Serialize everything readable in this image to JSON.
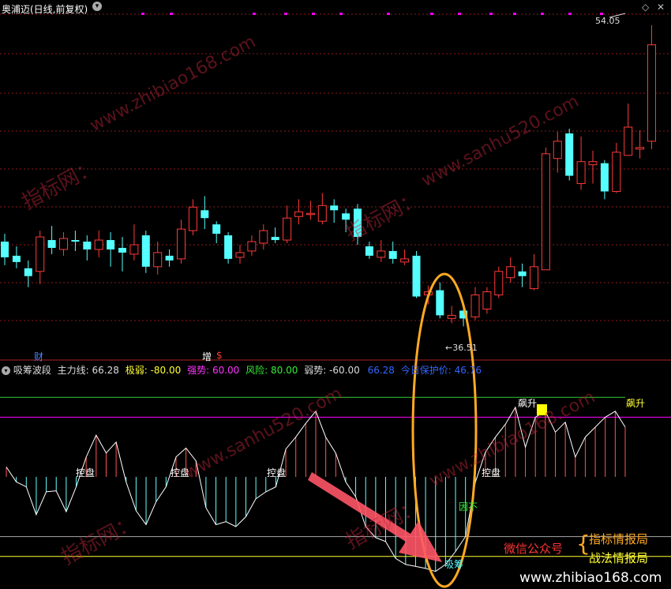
{
  "header": {
    "title": "奥浦迈(日线,前复权)",
    "collapse_icon": "chevron-down-icon"
  },
  "top_right_icons": [
    "diamond-icon",
    "close-icon"
  ],
  "indicator_header": {
    "name": "吸筹波段",
    "main_force": "主力线: 66.28",
    "extreme_weak": "极弱: -80.00",
    "strong": "强势: 60.00",
    "risk": "风险: 80.00",
    "weak": "弱势: -60.00",
    "value_blue": "66.28",
    "today_price": "今日保护价: 46.76"
  },
  "price_labels": {
    "high": "54.05",
    "low": "36.51"
  },
  "markers": {
    "cai": "财",
    "zeng": "增",
    "s": "$"
  },
  "indicator_labels": {
    "kongpan": "控盘",
    "biaosheng": "飙升",
    "xichou": "吸筹",
    "yinchu": "因不"
  },
  "watermarks": {
    "site1": "www.zhibiao168.com",
    "site2": "www.sanhu520.com",
    "brand": "指标网：",
    "wechat": "微信公众号",
    "brand_a": "指标情报局",
    "brand_b": "战法情报局",
    "footer": "www.zhibiao168.com"
  },
  "colors": {
    "up": "#ff3a3a",
    "down": "#55ffff",
    "magenta": "#ff00ff",
    "green_line": "#33cc33",
    "yellow_line": "#ffff33",
    "ellipse": "#ffaa22",
    "arrow": "#ff5566"
  },
  "chart_data": {
    "type": "candlestick",
    "price_ylim": [
      34,
      56
    ],
    "candles": [
      [
        41.5,
        40.5,
        42.0,
        40.0
      ],
      [
        40.6,
        40.2,
        41.2,
        39.8
      ],
      [
        39.8,
        39.3,
        40.3,
        38.6
      ],
      [
        39.6,
        41.8,
        42.2,
        38.8
      ],
      [
        41.6,
        41.1,
        42.5,
        40.7
      ],
      [
        41.0,
        41.7,
        42.1,
        40.6
      ],
      [
        41.6,
        41.5,
        42.2,
        40.9
      ],
      [
        41.5,
        41.0,
        41.9,
        40.3
      ],
      [
        41.0,
        41.6,
        42.2,
        40.5
      ],
      [
        41.6,
        41.0,
        42.1,
        39.9
      ],
      [
        41.1,
        40.8,
        41.8,
        39.6
      ],
      [
        40.7,
        41.3,
        42.6,
        40.3
      ],
      [
        41.9,
        39.9,
        42.2,
        39.5
      ],
      [
        39.9,
        40.8,
        41.5,
        39.4
      ],
      [
        40.6,
        40.3,
        41.0,
        39.9
      ],
      [
        40.4,
        42.3,
        42.9,
        40.1
      ],
      [
        42.2,
        43.7,
        44.2,
        41.9
      ],
      [
        43.5,
        43.0,
        44.4,
        42.3
      ],
      [
        42.6,
        42.0,
        42.8,
        41.4
      ],
      [
        41.9,
        40.4,
        42.1,
        40.1
      ],
      [
        40.5,
        40.8,
        41.3,
        40.1
      ],
      [
        40.9,
        41.5,
        41.9,
        40.6
      ],
      [
        41.4,
        42.2,
        42.6,
        41.0
      ],
      [
        41.8,
        41.6,
        42.4,
        41.4
      ],
      [
        41.6,
        43.0,
        43.8,
        41.4
      ],
      [
        43.1,
        43.4,
        44.2,
        42.6
      ],
      [
        43.3,
        43.3,
        44.1,
        42.9
      ],
      [
        42.8,
        43.8,
        44.6,
        42.6
      ],
      [
        43.8,
        43.5,
        44.2,
        42.7
      ],
      [
        43.3,
        42.9,
        43.6,
        42.1
      ],
      [
        43.6,
        41.8,
        43.9,
        41.3
      ],
      [
        41.2,
        40.6,
        41.5,
        40.4
      ],
      [
        40.5,
        40.9,
        41.6,
        40.2
      ],
      [
        40.9,
        40.4,
        41.5,
        40.1
      ],
      [
        40.2,
        40.4,
        41.0,
        40.0
      ],
      [
        40.6,
        38.0,
        40.9,
        37.9
      ],
      [
        38.1,
        38.3,
        38.7,
        37.5
      ],
      [
        38.4,
        36.8,
        38.9,
        36.6
      ],
      [
        36.6,
        36.8,
        37.4,
        36.3
      ],
      [
        37.1,
        36.6,
        37.4,
        36.1
      ],
      [
        36.7,
        38.1,
        38.6,
        36.5
      ],
      [
        37.2,
        38.3,
        38.6,
        36.9
      ],
      [
        38.1,
        39.6,
        39.9,
        37.9
      ],
      [
        39.2,
        39.9,
        40.5,
        38.9
      ],
      [
        39.6,
        39.3,
        40.1,
        38.6
      ],
      [
        38.5,
        39.9,
        40.7,
        38.4
      ],
      [
        39.7,
        47.1,
        47.5,
        39.7
      ],
      [
        46.8,
        47.9,
        48.5,
        45.9
      ],
      [
        48.4,
        45.7,
        48.7,
        45.4
      ],
      [
        45.2,
        46.6,
        48.2,
        44.8
      ],
      [
        46.4,
        46.6,
        47.3,
        45.2
      ],
      [
        46.5,
        44.7,
        46.7,
        44.2
      ],
      [
        44.7,
        47.2,
        47.8,
        44.6
      ],
      [
        47.0,
        48.8,
        50.3,
        47.1
      ],
      [
        47.4,
        47.5,
        48.6,
        46.8
      ],
      [
        47.9,
        54.05,
        55.3,
        47.4
      ]
    ],
    "indicator_ylim": [
      -100,
      100
    ],
    "indicator_levels": {
      "risk": 80,
      "strong": 60,
      "zero": 0,
      "weak": -60,
      "extreme_weak": -80
    },
    "indicator": [
      10,
      -5,
      -10,
      -38,
      -15,
      -14,
      -35,
      -10,
      20,
      42,
      24,
      35,
      -5,
      -34,
      -48,
      -25,
      -10,
      20,
      29,
      16,
      -31,
      -48,
      -45,
      -50,
      -40,
      -22,
      -15,
      -10,
      28,
      40,
      54,
      66,
      40,
      24,
      -5,
      -20,
      -50,
      -61,
      -65,
      -82,
      -88,
      -90,
      -92,
      -95,
      -88,
      -75,
      -60,
      -5,
      25,
      40,
      53,
      70,
      30,
      60,
      66,
      45,
      55,
      20,
      40,
      50,
      60,
      66,
      50
    ]
  }
}
